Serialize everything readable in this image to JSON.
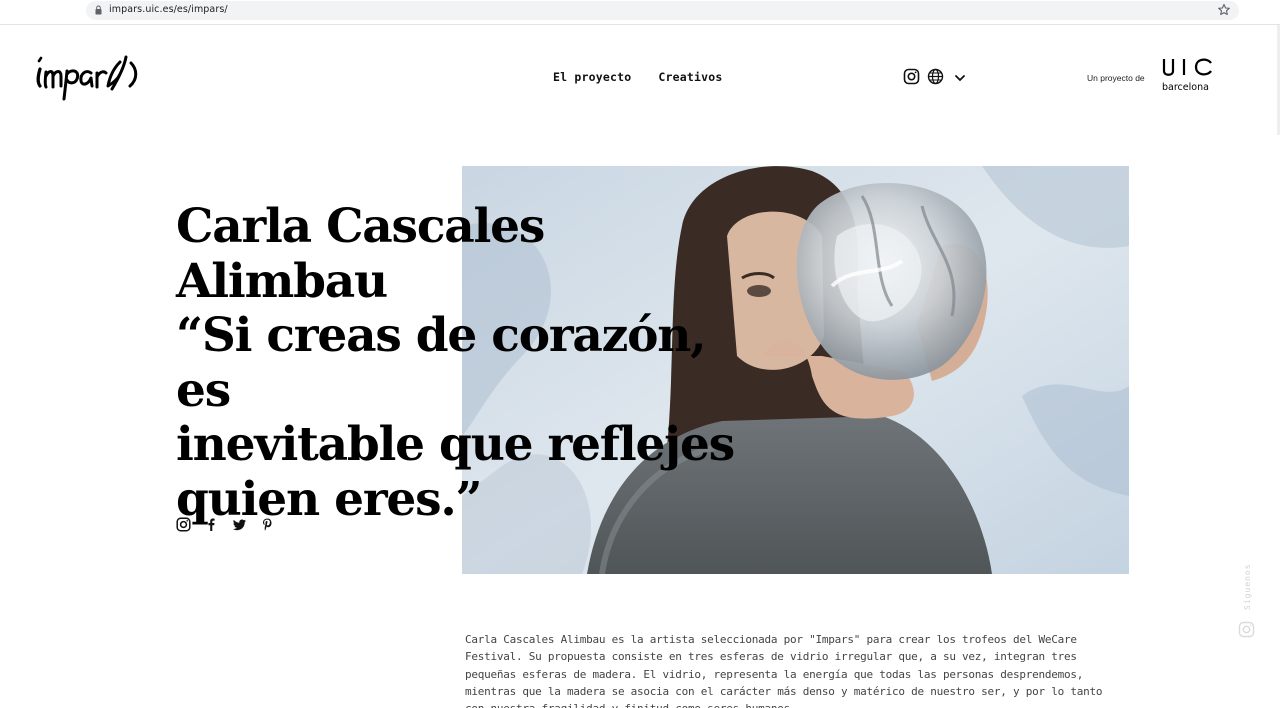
{
  "browser": {
    "url": "impars.uic.es/es/impars/"
  },
  "header": {
    "logo_text": "impars",
    "nav": [
      {
        "label": "El proyecto"
      },
      {
        "label": "Creativos"
      }
    ],
    "project_label": "Un proyecto de",
    "uic_logo_text": "uic",
    "uic_logo_sub": "barcelona"
  },
  "hero": {
    "name_line1": "Carla Cascales",
    "name_line2": "Alimbau",
    "quote_line1": "“Si creas de corazón, es",
    "quote_line2": "inevitable que reflejes",
    "quote_line3": "quien eres.”"
  },
  "side": {
    "follow_label": "Síguenos"
  },
  "article": {
    "paragraph": "Carla Cascales Alimbau es la artista seleccionada por \"Impars\" para crear los trofeos del WeCare Festival. Su propuesta consiste en tres esferas de vidrio irregular que, a su vez, integran tres pequeñas esferas de madera. El vidrio, representa la energía que todas las personas desprendemos, mientras que la madera se asocia con el carácter más denso y matérico de nuestro ser, y por lo tanto con nuestra fragilidad y finitud como seres humanos."
  },
  "colors": {
    "text": "#000000",
    "body_text": "#444444",
    "url_bar_bg": "#f1f3f4"
  },
  "icons": [
    "lock-icon",
    "star-icon",
    "instagram-icon",
    "globe-icon",
    "chevron-down-icon",
    "facebook-icon",
    "twitter-icon",
    "pinterest-icon"
  ]
}
